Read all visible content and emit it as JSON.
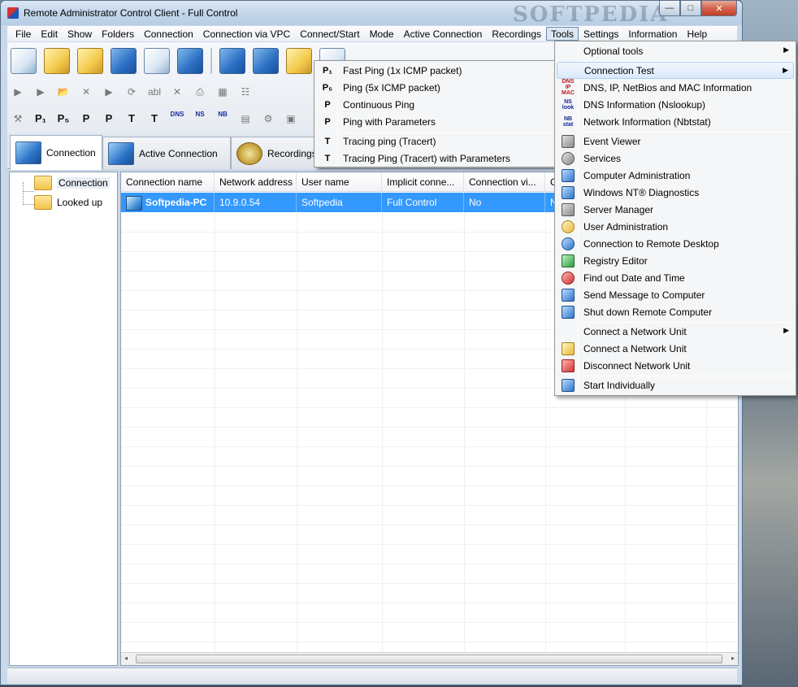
{
  "window": {
    "title": "Remote Administrator Control Client - Full Control",
    "watermark": "SOFTPEDIA",
    "minimize_glyph": "—",
    "maximize_glyph": "□",
    "close_glyph": "✕"
  },
  "menubar": {
    "items": [
      "File",
      "Edit",
      "Show",
      "Folders",
      "Connection",
      "Connection via VPC",
      "Connect/Start",
      "Mode",
      "Active Connection",
      "Recordings",
      "Tools",
      "Settings",
      "Information",
      "Help"
    ]
  },
  "toolbar": {
    "row2_glyphs": [
      "▶",
      "▶",
      "📂",
      "✕",
      "▶",
      "⟳",
      "abl",
      "✕",
      "⎙",
      "▦",
      "☷"
    ],
    "row3_glyphs": [
      "⚒",
      "P₁",
      "P₅",
      "P",
      "P",
      "T",
      "T",
      "DNS",
      "NS",
      "NB",
      "▤",
      "⚙",
      "▣"
    ]
  },
  "tabs": [
    {
      "label": "Connection"
    },
    {
      "label": "Active Connection"
    },
    {
      "label": "Recordings"
    }
  ],
  "tree": {
    "items": [
      {
        "label": "Connection"
      },
      {
        "label": "Looked up"
      }
    ]
  },
  "list": {
    "columns": [
      "Connection name",
      "Network address",
      "User name",
      "Implicit conne...",
      "Connection vi...",
      "C"
    ],
    "rows": [
      {
        "name": "Softpedia-PC",
        "address": "10.9.0.54",
        "user": "Softpedia",
        "implicit": "Full Control",
        "via": "No",
        "c": "N"
      }
    ],
    "scroll_left": "◂",
    "scroll_right": "▸"
  },
  "tools_menu": {
    "items": [
      {
        "label": "Optional tools",
        "icon": "",
        "submenu": true
      },
      {
        "label": "Connection Test",
        "icon": "",
        "submenu": true,
        "highlighted": true
      },
      {
        "label": "DNS, IP, NetBios and MAC Information",
        "icon": "DNS IP MAC"
      },
      {
        "label": "DNS Information (Nslookup)",
        "icon": "NS look"
      },
      {
        "label": "Network Information (Nbtstat)",
        "icon": "NB stat"
      },
      {
        "label": "Event Viewer",
        "icon": ""
      },
      {
        "label": "Services",
        "icon": ""
      },
      {
        "label": "Computer Administration",
        "icon": ""
      },
      {
        "label": "Windows NT® Diagnostics",
        "icon": ""
      },
      {
        "label": "Server Manager",
        "icon": ""
      },
      {
        "label": "User Administration",
        "icon": ""
      },
      {
        "label": "Connection to Remote Desktop",
        "icon": ""
      },
      {
        "label": "Registry Editor",
        "icon": ""
      },
      {
        "label": "Find out Date and Time",
        "icon": ""
      },
      {
        "label": "Send Message to Computer",
        "icon": ""
      },
      {
        "label": "Shut down Remote Computer",
        "icon": ""
      },
      {
        "label": "Connect a Network Unit",
        "icon": "",
        "submenu": true
      },
      {
        "label": "Connect a Network Unit",
        "icon": ""
      },
      {
        "label": "Disconnect Network Unit",
        "icon": ""
      },
      {
        "label": "Start Individually",
        "icon": ""
      }
    ],
    "submenu_arrow": "▶"
  },
  "connection_test_menu": {
    "items": [
      {
        "icon": "P₁",
        "label": "Fast Ping (1x ICMP packet)"
      },
      {
        "icon": "P₅",
        "label": "Ping (5x ICMP packet)"
      },
      {
        "icon": "P",
        "label": "Continuous Ping"
      },
      {
        "icon": "P",
        "label": "Ping with Parameters"
      },
      {
        "icon": "T",
        "label": "Tracing ping (Tracert)"
      },
      {
        "icon": "T",
        "label": "Tracing Ping (Tracert) with Parameters"
      }
    ]
  },
  "colors": {
    "selection": "#3399ff",
    "titlebar": "#c3d6ea",
    "menu_background": "#f5f6f7"
  }
}
